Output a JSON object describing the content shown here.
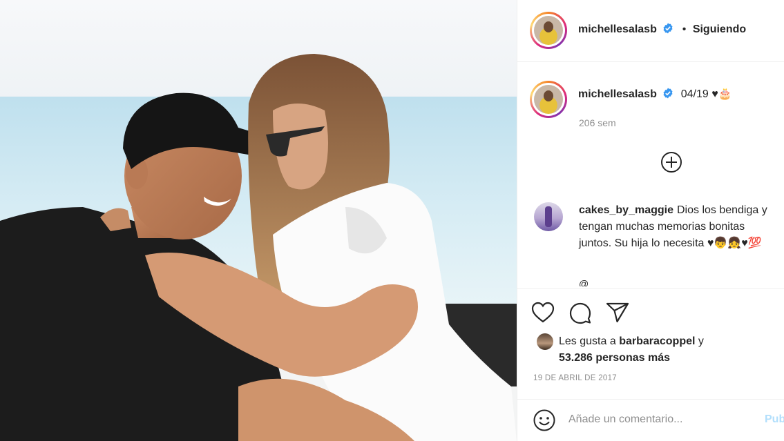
{
  "header": {
    "username": "michellesalasb",
    "separator": "•",
    "follow_label": "Siguiendo"
  },
  "caption": {
    "username": "michellesalasb",
    "text": "04/19 ♥🎂",
    "time": "206 sem"
  },
  "comment": {
    "username": "cakes_by_maggie",
    "text": "Dios los bendiga y tengan muchas memorias bonitas juntos. Su hija lo necesita ♥👦👧♥💯",
    "next_line_partial": "@______ ____"
  },
  "likes": {
    "prefix": "Les gusta a",
    "user": "barbaracoppel",
    "suffix": "y",
    "count_text": "53.286 personas más"
  },
  "post_date": "19 DE ABRIL DE 2017",
  "add_comment": {
    "placeholder": "Añade un comentario...",
    "post_label": "Publicar"
  },
  "icons": {
    "like": "heart-icon",
    "comment": "speech-bubble-icon",
    "share": "paper-plane-icon",
    "emoji": "smiley-icon",
    "add": "plus-circle-icon",
    "verified": "verified-badge-icon"
  },
  "colors": {
    "verified": "#3897f0",
    "post_button": "#b2dffc",
    "muted": "#8e8e8e"
  }
}
